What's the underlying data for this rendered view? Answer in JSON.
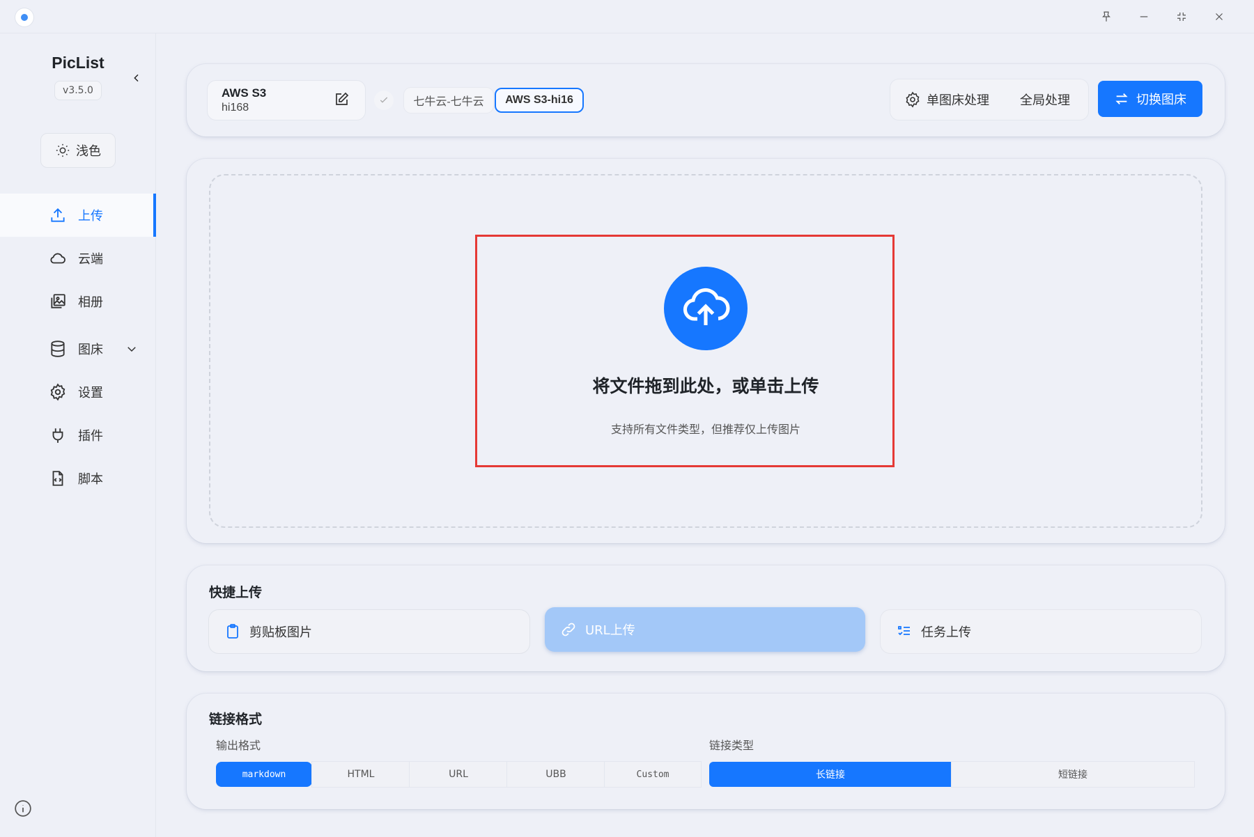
{
  "window": {
    "controls": [
      "pin-icon",
      "minimize-icon",
      "restore-icon",
      "close-icon"
    ]
  },
  "sidebar": {
    "brand": "PicList",
    "version": "v3.5.0",
    "theme_label": "浅色",
    "items": [
      {
        "label": "上传",
        "icon": "upload-icon",
        "active": true
      },
      {
        "label": "云端",
        "icon": "cloud-icon"
      },
      {
        "label": "相册",
        "icon": "gallery-icon"
      },
      {
        "label": "图床",
        "icon": "database-icon",
        "expandable": true
      },
      {
        "label": "设置",
        "icon": "gear-icon"
      },
      {
        "label": "插件",
        "icon": "plug-icon"
      },
      {
        "label": "脚本",
        "icon": "script-icon"
      }
    ]
  },
  "header": {
    "picbed_name": "AWS S3",
    "picbed_id": "hi168",
    "config_tabs": [
      {
        "label": "七牛云-七牛云",
        "selected": false
      },
      {
        "label": "AWS S3-hi16",
        "selected": true
      }
    ],
    "single_process_label": "单图床处理",
    "global_process_label": "全局处理",
    "switch_label": "切换图床"
  },
  "upload": {
    "title": "将文件拖到此处，或单击上传",
    "subtitle": "支持所有文件类型，但推荐仅上传图片"
  },
  "quick_upload": {
    "title": "快捷上传",
    "buttons": [
      {
        "label": "剪贴板图片",
        "icon": "clipboard-icon"
      },
      {
        "label": "URL上传",
        "icon": "link-icon",
        "highlighted": true
      },
      {
        "label": "任务上传",
        "icon": "task-list-icon"
      }
    ]
  },
  "link_format": {
    "title": "链接格式",
    "output_label": "输出格式",
    "output_options": [
      "markdown",
      "HTML",
      "URL",
      "UBB",
      "Custom"
    ],
    "output_selected": "markdown",
    "type_label": "链接类型",
    "type_options": [
      "长链接",
      "短链接"
    ],
    "type_selected": "长链接"
  },
  "colors": {
    "accent": "#1677ff",
    "highlight_border": "#e53935",
    "background": "#eef0f7"
  }
}
